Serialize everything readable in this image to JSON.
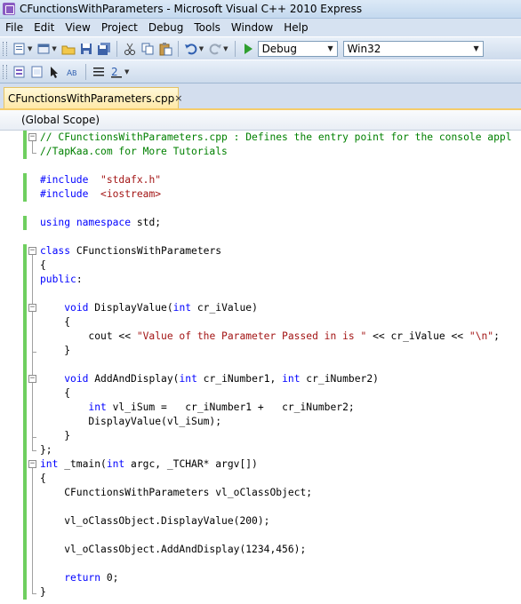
{
  "window": {
    "title": "CFunctionsWithParameters - Microsoft Visual C++ 2010 Express"
  },
  "menu": [
    "File",
    "Edit",
    "View",
    "Project",
    "Debug",
    "Tools",
    "Window",
    "Help"
  ],
  "toolbar": {
    "config": "Debug",
    "platform": "Win32"
  },
  "tab": {
    "label": "CFunctionsWithParameters.cpp",
    "close": "×"
  },
  "scope": {
    "label": "(Global Scope)"
  },
  "code": [
    [
      [
        "cm",
        "// CFunctionsWithParameters.cpp : Defines the entry point for the console appl"
      ]
    ],
    [
      [
        "cm",
        "//TapKaa.com for More Tutorials"
      ]
    ],
    [],
    [
      [
        "kw",
        "#include"
      ],
      [
        "",
        "  "
      ],
      [
        "str",
        "\"stdafx.h\""
      ]
    ],
    [
      [
        "kw",
        "#include"
      ],
      [
        "",
        "  "
      ],
      [
        "str",
        "<iostream>"
      ]
    ],
    [],
    [
      [
        "kw",
        "using"
      ],
      [
        "",
        " "
      ],
      [
        "kw",
        "namespace"
      ],
      [
        "",
        " std;"
      ]
    ],
    [],
    [
      [
        "kw",
        "class"
      ],
      [
        "",
        " CFunctionsWithParameters"
      ]
    ],
    [
      [
        "",
        "{"
      ]
    ],
    [
      [
        "kw",
        "public"
      ],
      [
        "",
        ":"
      ]
    ],
    [],
    [
      [
        "",
        "    "
      ],
      [
        "kw",
        "void"
      ],
      [
        "",
        " DisplayValue("
      ],
      [
        "kw",
        "int"
      ],
      [
        "",
        " cr_iValue)"
      ]
    ],
    [
      [
        "",
        "    {"
      ]
    ],
    [
      [
        "",
        "        cout << "
      ],
      [
        "str",
        "\"Value of the Parameter Passed in is \""
      ],
      [
        "",
        " << cr_iValue << "
      ],
      [
        "str",
        "\"\\n\""
      ],
      [
        "",
        ";"
      ]
    ],
    [
      [
        "",
        "    }"
      ]
    ],
    [],
    [
      [
        "",
        "    "
      ],
      [
        "kw",
        "void"
      ],
      [
        "",
        " AddAndDisplay("
      ],
      [
        "kw",
        "int"
      ],
      [
        "",
        " cr_iNumber1, "
      ],
      [
        "kw",
        "int"
      ],
      [
        "",
        " cr_iNumber2)"
      ]
    ],
    [
      [
        "",
        "    {"
      ]
    ],
    [
      [
        "",
        "        "
      ],
      [
        "kw",
        "int"
      ],
      [
        "",
        " vl_iSum =   cr_iNumber1 +   cr_iNumber2;"
      ]
    ],
    [
      [
        "",
        "        DisplayValue(vl_iSum);"
      ]
    ],
    [
      [
        "",
        "    }"
      ]
    ],
    [
      [
        "",
        "};"
      ]
    ],
    [
      [
        "kw",
        "int"
      ],
      [
        "",
        " _tmain("
      ],
      [
        "kw",
        "int"
      ],
      [
        "",
        " argc, _TCHAR* argv[])"
      ]
    ],
    [
      [
        "",
        "{"
      ]
    ],
    [
      [
        "",
        "    CFunctionsWithParameters vl_oClassObject;"
      ]
    ],
    [],
    [
      [
        "",
        "    vl_oClassObject.DisplayValue(200);"
      ]
    ],
    [],
    [
      [
        "",
        "    vl_oClassObject.AddAndDisplay(1234,456);"
      ]
    ],
    [],
    [
      [
        "",
        "    "
      ],
      [
        "kw",
        "return"
      ],
      [
        "",
        " 0;"
      ]
    ],
    [
      [
        "",
        "}"
      ]
    ]
  ]
}
